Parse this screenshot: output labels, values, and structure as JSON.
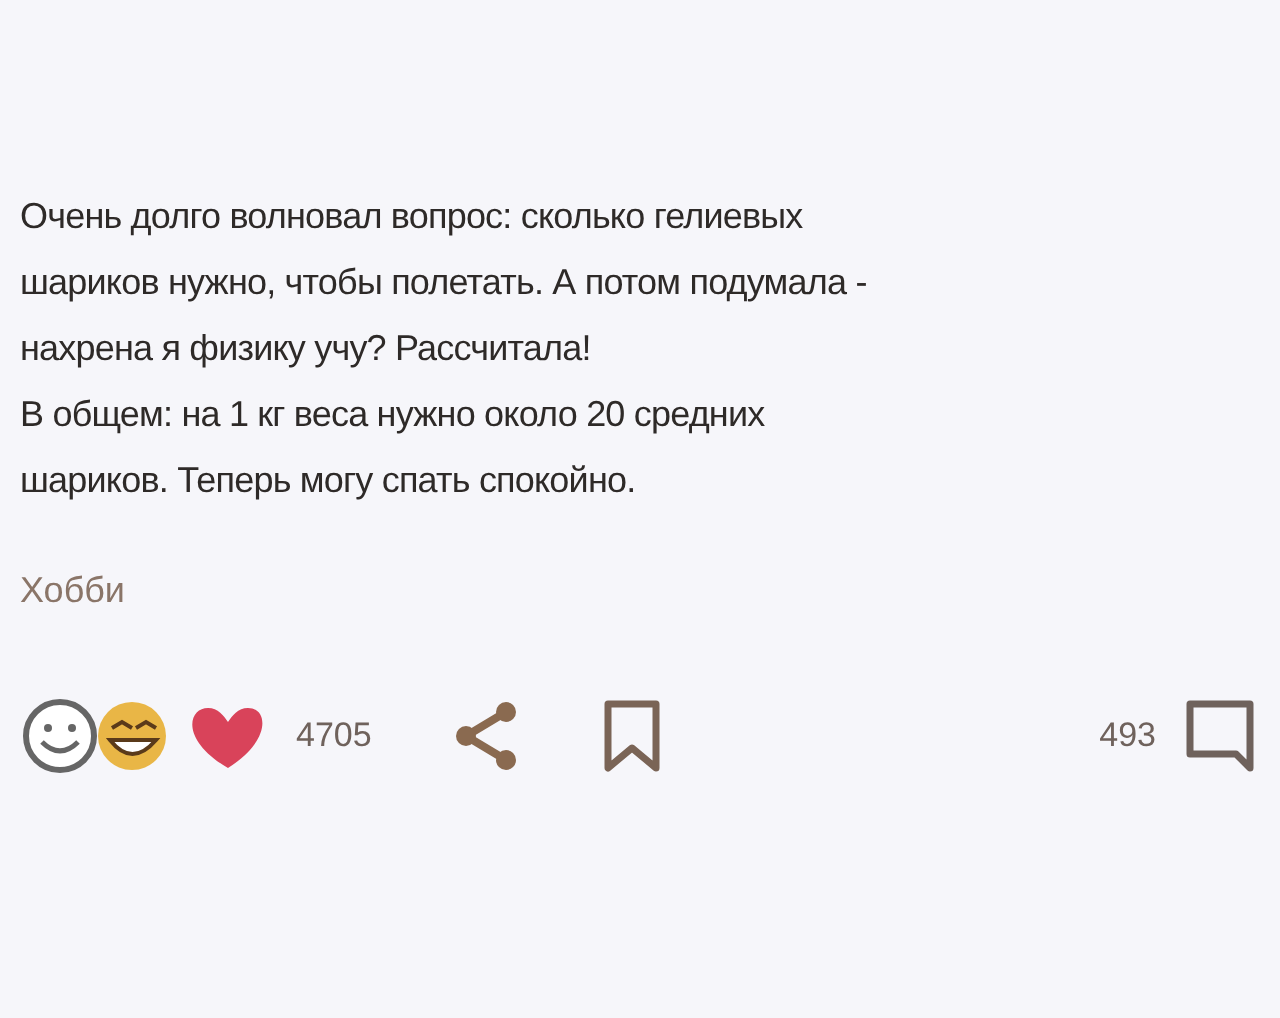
{
  "post": {
    "text": "Очень долго волновал вопрос: сколько гелиевых\nшариков нужно, чтобы полетать. А потом подумала -\nнахрена я физику учу? Рассчитала!\nВ общем: на 1 кг веса нужно около 20 средних\nшариков. Теперь могу спать спокойно.",
    "category": "Хобби"
  },
  "footer": {
    "reactions_count": "4705",
    "comments_count": "493"
  }
}
